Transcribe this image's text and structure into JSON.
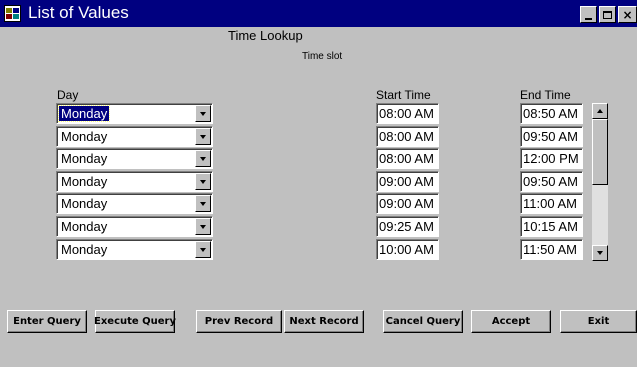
{
  "window": {
    "title": "List of Values",
    "controls": {
      "minimize": "minimize",
      "maximize": "maximize",
      "close": "×"
    }
  },
  "header": {
    "title": "Time Lookup",
    "subtitle": "Time slot"
  },
  "columns": {
    "day": "Day",
    "start": "Start Time",
    "end": "End Time"
  },
  "rows": [
    {
      "day": "Monday",
      "start": "08:00 AM",
      "end": "08:50 AM"
    },
    {
      "day": "Monday",
      "start": "08:00 AM",
      "end": "09:50 AM"
    },
    {
      "day": "Monday",
      "start": "08:00 AM",
      "end": "12:00 PM"
    },
    {
      "day": "Monday",
      "start": "09:00 AM",
      "end": "09:50 AM"
    },
    {
      "day": "Monday",
      "start": "09:00 AM",
      "end": "11:00 AM"
    },
    {
      "day": "Monday",
      "start": "09:25 AM",
      "end": "10:15 AM"
    },
    {
      "day": "Monday",
      "start": "10:00 AM",
      "end": "11:50 AM"
    }
  ],
  "selected_row": 0,
  "buttons": {
    "enter_query": "Enter Query",
    "execute_query": "Execute Query",
    "prev_record": "Prev Record",
    "next_record": "Next Record",
    "cancel_query": "Cancel Query",
    "accept": "Accept",
    "exit": "Exit"
  },
  "icons": {
    "app": "app-window-icon",
    "dropdown": "chevron-down-icon",
    "scroll_up": "arrow-up-icon",
    "scroll_down": "arrow-down-icon"
  },
  "colors": {
    "titlebar": "#000080",
    "background": "#c0c0c0",
    "selection": "#000080"
  }
}
